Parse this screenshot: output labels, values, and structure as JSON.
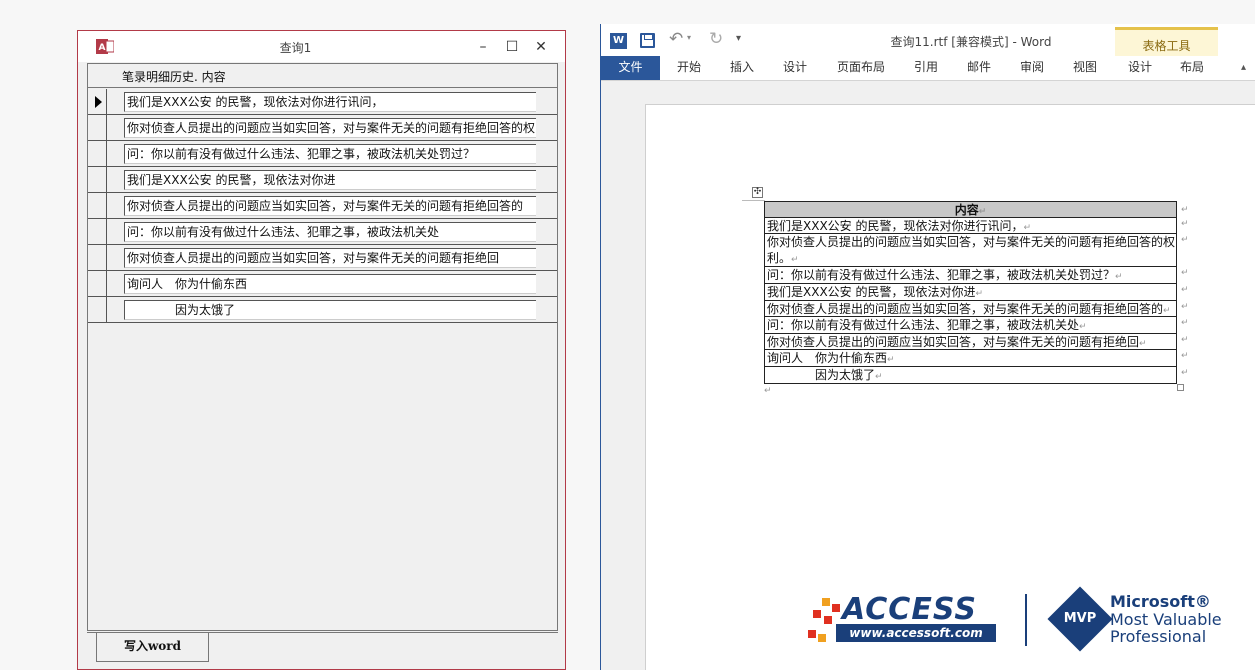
{
  "access": {
    "window_title": "查询1",
    "column_header": "笔录明细历史. 内容",
    "rows": [
      "我们是XXX公安 的民警，现依法对你进行讯问，",
      "你对侦查人员提出的问题应当如实回答，对与案件无关的问题有拒绝回答的权",
      "问：你以前有没有做过什么违法、犯罪之事，被政法机关处罚过？",
      "我们是XXX公安 的民警，现依法对你进",
      "你对侦查人员提出的问题应当如实回答，对与案件无关的问题有拒绝回答的",
      "问：你以前有没有做过什么违法、犯罪之事，被政法机关处",
      "你对侦查人员提出的问题应当如实回答，对与案件无关的问题有拒绝回",
      "询问人　你为什偷东西",
      "　　　　因为太饿了"
    ],
    "write_button": "写入word",
    "controls": {
      "minimize": "–",
      "maximize": "☐",
      "close": "✕"
    }
  },
  "word": {
    "window_title": "查询11.rtf [兼容模式] - Word",
    "word_icon": "W",
    "contextual_group": "表格工具",
    "tabs": [
      "文件",
      "开始",
      "插入",
      "设计",
      "页面布局",
      "引用",
      "邮件",
      "审阅",
      "视图",
      "设计",
      "布局"
    ],
    "collapse": "▴",
    "qat": {
      "undo": "↶",
      "redo": "↻",
      "undo_dropdown": "▾",
      "more": "▾"
    },
    "table": {
      "move_handle": "✣",
      "header": "内容",
      "rows": [
        "我们是XXX公安 的民警，现依法对你进行讯问，",
        "你对侦查人员提出的问题应当如实回答，对与案件无关的问题有拒绝回答的权利。",
        "问：你以前有没有做过什么违法、犯罪之事，被政法机关处罚过？",
        "我们是XXX公安 的民警，现依法对你进",
        "你对侦查人员提出的问题应当如实回答，对与案件无关的问题有拒绝回答的",
        "问：你以前有没有做过什么违法、犯罪之事，被政法机关处",
        "你对侦查人员提出的问题应当如实回答，对与案件无关的问题有拒绝回",
        "询问人　你为什偷东西",
        "　　　　因为太饿了"
      ],
      "para_mark": "↵"
    }
  },
  "logo": {
    "access_word": "ACCESS",
    "access_url": "www.accessoft.com",
    "mvp": "MVP",
    "ms_line1": "Microsoft®",
    "ms_line2": "Most Valuable",
    "ms_line3": "Professional"
  },
  "colors": {
    "word_blue": "#2b579a",
    "access_red": "#b23a48",
    "logo_blue": "#1a3f7a"
  }
}
